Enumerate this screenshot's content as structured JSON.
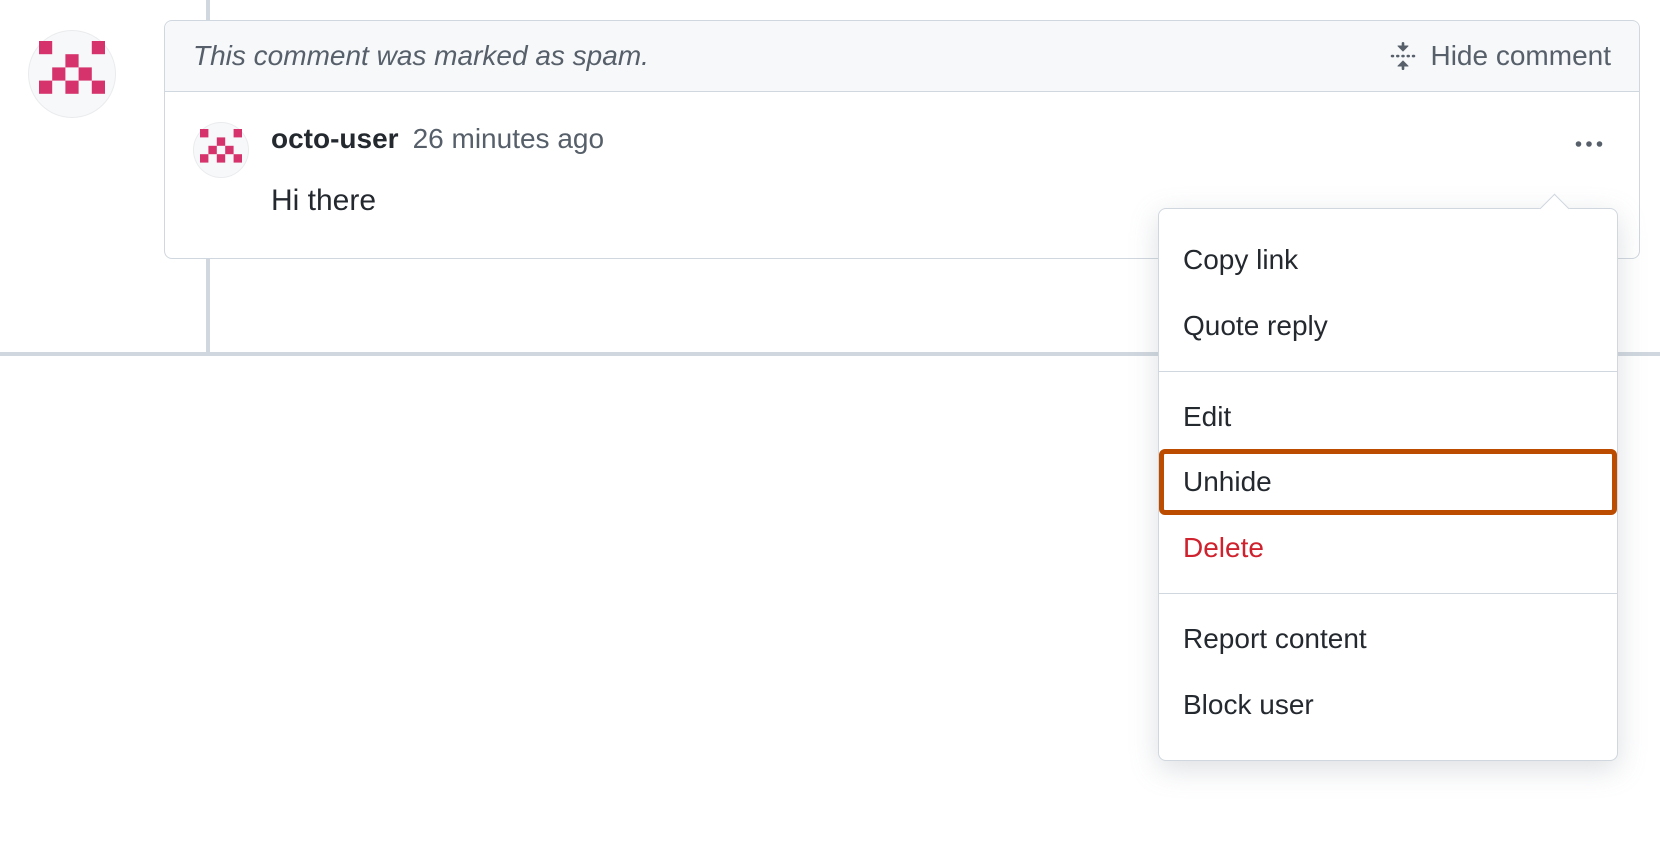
{
  "banner": {
    "spam_note": "This comment was marked as spam.",
    "hide_label": "Hide comment"
  },
  "comment": {
    "author": "octo-user",
    "timestamp": "26 minutes ago",
    "body": "Hi there"
  },
  "menu": {
    "copy_link": "Copy link",
    "quote_reply": "Quote reply",
    "edit": "Edit",
    "unhide": "Unhide",
    "delete": "Delete",
    "report_content": "Report content",
    "block_user": "Block user"
  },
  "icons": {
    "kebab": "kebab-horizontal-icon",
    "fold": "fold-icon",
    "avatar": "identicon"
  },
  "colors": {
    "border": "#d0d7de",
    "muted_text": "#57606a",
    "danger": "#cf222e",
    "highlight": "#bc4c00",
    "header_bg": "#f6f8fa"
  }
}
